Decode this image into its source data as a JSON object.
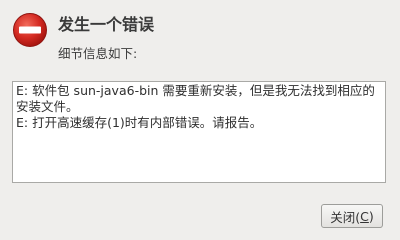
{
  "dialog": {
    "icon": "error-icon",
    "title": "发生一个错误",
    "subtitle": "细节信息如下:",
    "details": {
      "lines": [
        "E: 软件包 sun-java6-bin 需要重新安装，但是我无法找到相应的",
        "安装文件。",
        "E: 打开高速缓存(1)时有内部错误。请报告。"
      ]
    },
    "close_button": {
      "label": "关闭(",
      "mnemonic": "C",
      "label_end": ")"
    }
  },
  "colors": {
    "background": "#efeeec",
    "error_red": "#cc1f1f",
    "text_area_bg": "#ffffff"
  }
}
